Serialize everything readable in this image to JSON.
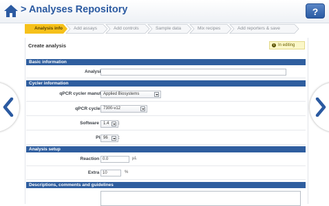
{
  "header": {
    "title": "> Analyses Repository",
    "help_label": "?"
  },
  "wizard": {
    "steps": [
      {
        "label": "Analysis info",
        "active": true
      },
      {
        "label": "Add assays",
        "active": false
      },
      {
        "label": "Add controls",
        "active": false
      },
      {
        "label": "Sample data",
        "active": false
      },
      {
        "label": "Mix recipes",
        "active": false
      },
      {
        "label": "Add reporters & save",
        "active": false
      }
    ]
  },
  "page": {
    "title": "Create analysis",
    "status_badge": "In editing"
  },
  "sections": {
    "basic": "Basic information",
    "cycler": "Cycler information",
    "setup": "Analysis setup",
    "descriptions": "Descriptions, comments and guidelines"
  },
  "fields": {
    "analysis_name": {
      "label": "Analysis name*:",
      "value": ""
    },
    "manufacturer": {
      "label": "qPCR cycler manufacturer*:",
      "value": "Applied Biosystems"
    },
    "model": {
      "label": "qPCR cycler model*:",
      "value": "7300-v12"
    },
    "software": {
      "label": "Software version*:",
      "value": "1.4"
    },
    "plate_size": {
      "label": "Plate size*:",
      "value": "96"
    },
    "reaction_volume": {
      "label": "Reaction volume*:",
      "value": "0.0",
      "unit": "µL"
    },
    "extra_volume": {
      "label": "Extra volume*:",
      "value": "10",
      "unit": "%"
    }
  },
  "colors": {
    "accent": "#2f5e9f",
    "active_step": "#f6c11a"
  },
  "icons": {
    "home": "home-icon",
    "prev": "chevron-left-icon",
    "next": "chevron-right-icon"
  }
}
